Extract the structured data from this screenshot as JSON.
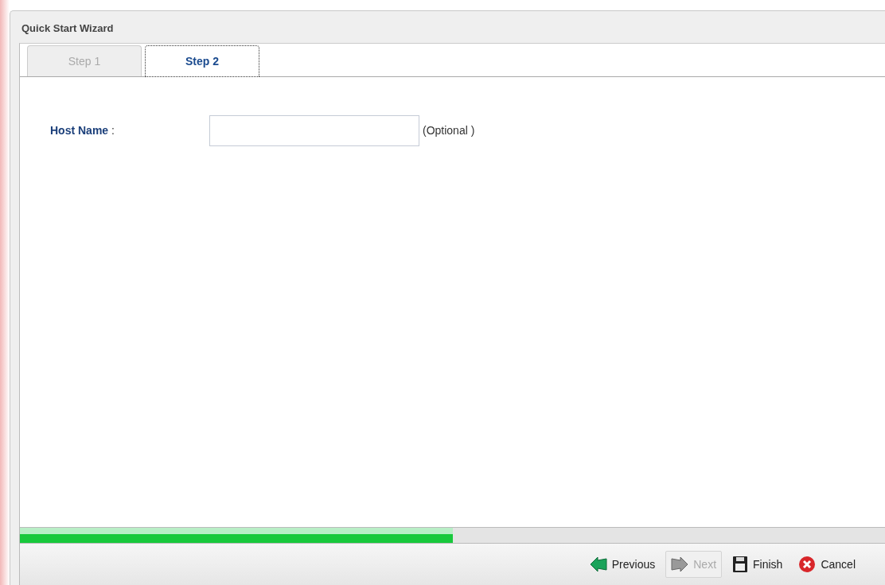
{
  "window": {
    "title": "Quick Start Wizard"
  },
  "tabs": [
    {
      "label": "Step 1",
      "selected": false
    },
    {
      "label": "Step 2",
      "selected": true
    }
  ],
  "form": {
    "fields": [
      {
        "label": "Host Name",
        "separator": ":",
        "hint": "(Optional )"
      }
    ]
  },
  "progress": {
    "level": 0.5
  },
  "buttons": [
    {
      "label": "Previous",
      "kind": "previous",
      "disabled": false
    },
    {
      "label": "Next",
      "kind": "next",
      "disabled": true
    },
    {
      "label": "Finish",
      "kind": "finish",
      "disabled": false
    },
    {
      "label": "Cancel",
      "kind": "cancel",
      "disabled": false
    }
  ]
}
